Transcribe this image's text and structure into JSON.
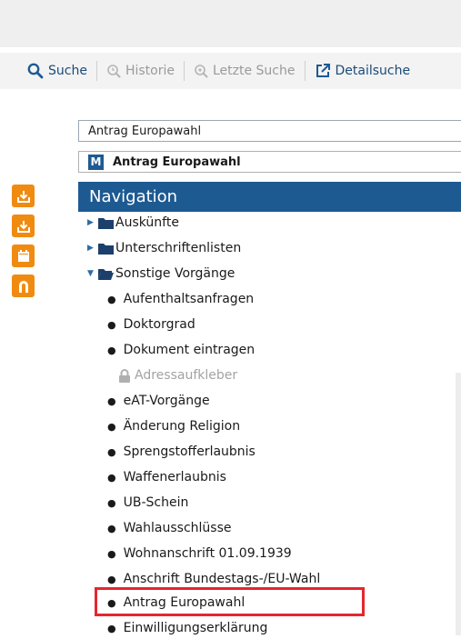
{
  "toolbar": {
    "items": [
      {
        "label": "Suche",
        "icon": "search-icon",
        "state": "active"
      },
      {
        "label": "Historie",
        "icon": "history-search-icon",
        "state": "disabled"
      },
      {
        "label": "Letzte Suche",
        "icon": "last-search-icon",
        "state": "disabled"
      },
      {
        "label": "Detailsuche",
        "icon": "external-link-icon",
        "state": "active"
      }
    ]
  },
  "search": {
    "value": "Antrag Europawahl",
    "suggestion_badge": "M",
    "suggestion": "Antrag Europawahl"
  },
  "side_tools": [
    "download-icon",
    "download-alt-icon",
    "calendar-icon",
    "magnet-icon"
  ],
  "navigation": {
    "title": "Navigation",
    "folders": [
      {
        "label": "Auskünfte",
        "expanded": false
      },
      {
        "label": "Unterschriftenlisten",
        "expanded": false
      },
      {
        "label": "Sonstige Vorgänge",
        "expanded": true
      }
    ],
    "items": [
      {
        "label": "Aufenthaltsanfragen",
        "locked": false
      },
      {
        "label": "Doktorgrad",
        "locked": false
      },
      {
        "label": "Dokument eintragen",
        "locked": false
      },
      {
        "label": "Adressaufkleber",
        "locked": true
      },
      {
        "label": "eAT-Vorgänge",
        "locked": false
      },
      {
        "label": "Änderung Religion",
        "locked": false
      },
      {
        "label": "Sprengstofferlaubnis",
        "locked": false
      },
      {
        "label": "Waffenerlaubnis",
        "locked": false
      },
      {
        "label": "UB-Schein",
        "locked": false
      },
      {
        "label": "Wahlausschlüsse",
        "locked": false
      },
      {
        "label": "Wohnanschrift 01.09.1939",
        "locked": false
      },
      {
        "label": "Anschrift Bundestags-/EU-Wahl",
        "locked": false
      },
      {
        "label": "Antrag Europawahl",
        "locked": false,
        "highlighted": true
      },
      {
        "label": "Einwilligungserklärung",
        "locked": false
      }
    ]
  },
  "colors": {
    "brand_blue": "#1d5a92",
    "accent_orange": "#f08b12",
    "highlight_red": "#e5262e"
  }
}
